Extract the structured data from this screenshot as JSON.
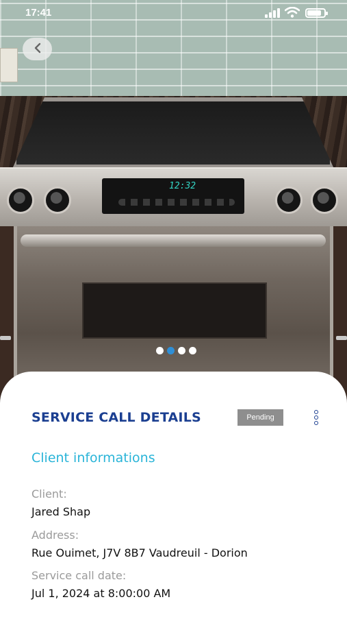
{
  "status_bar": {
    "time": "17:41",
    "signal_icon": "cellular-signal-icon",
    "wifi_icon": "wifi-icon",
    "battery_icon": "battery-icon",
    "battery_level": 0.85
  },
  "hero": {
    "image_subject": "stainless steel electric range",
    "back_icon": "chevron-left-icon",
    "carousel": {
      "count": 4,
      "active_index": 1
    },
    "clock_display": "12:32"
  },
  "details": {
    "title": "SERVICE CALL DETAILS",
    "status_badge": "Pending",
    "more_icon": "vertical-more-icon",
    "section_title": "Client informations",
    "fields": [
      {
        "label": "Client:",
        "value": "Jared Shap"
      },
      {
        "label": "Address:",
        "value": "Rue Ouimet, J7V 8B7 Vaudreuil - Dorion"
      },
      {
        "label": "Service call date:",
        "value": "Jul 1, 2024 at 8:00:00 AM"
      }
    ]
  },
  "colors": {
    "title": "#1b3f91",
    "section": "#29b4d8",
    "badge_bg": "#8e8e8e",
    "label": "#9a9a9a",
    "value": "#111111",
    "carousel_active": "#2f8fd6"
  }
}
